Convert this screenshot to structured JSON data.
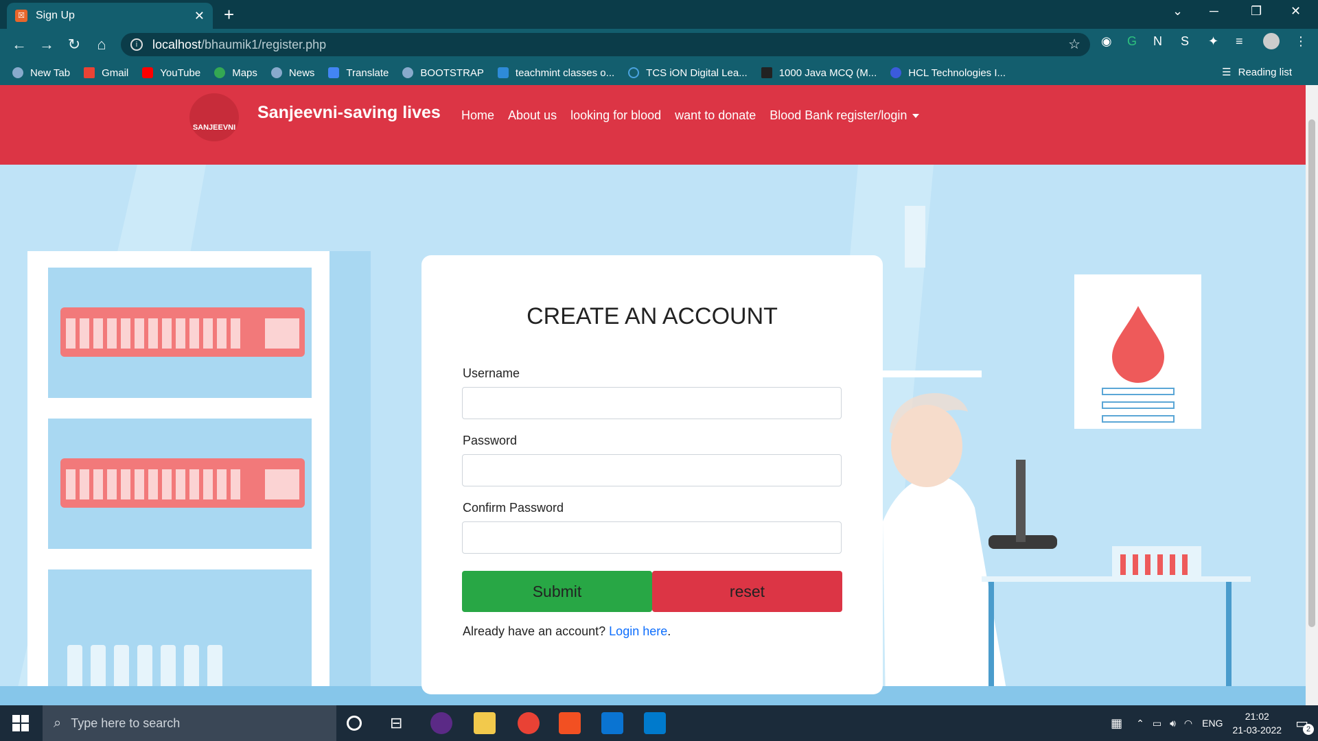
{
  "browser": {
    "tab_title": "Sign Up",
    "url_host": "localhost",
    "url_path": "/bhaumik1/register.php",
    "bookmarks": [
      "New Tab",
      "Gmail",
      "YouTube",
      "Maps",
      "News",
      "Translate",
      "BOOTSTRAP",
      "teachmint classes o...",
      "TCS iON Digital Lea...",
      "1000 Java MCQ (M...",
      "HCL Technologies I..."
    ],
    "reading_list": "Reading list"
  },
  "site": {
    "logo_text": "SANJEEVNI",
    "brand": "Sanjeevni-saving lives",
    "nav": {
      "home": "Home",
      "about": "About us",
      "looking": "looking for blood",
      "donate": "want to donate",
      "bank": "Blood Bank register/login"
    }
  },
  "form": {
    "title": "CREATE AN ACCOUNT",
    "username_label": "Username",
    "password_label": "Password",
    "confirm_label": "Confirm Password",
    "submit_label": "Submit",
    "reset_label": "reset",
    "already_text": "Already have an account?",
    "login_link": "Login here",
    "login_period": "."
  },
  "taskbar": {
    "search_placeholder": "Type here to search",
    "lang": "ENG",
    "time": "21:02",
    "date": "21-03-2022",
    "notif_count": "2"
  },
  "colors": {
    "primary_red": "#dc3545",
    "success_green": "#28a745",
    "link_blue": "#0d6efd"
  }
}
